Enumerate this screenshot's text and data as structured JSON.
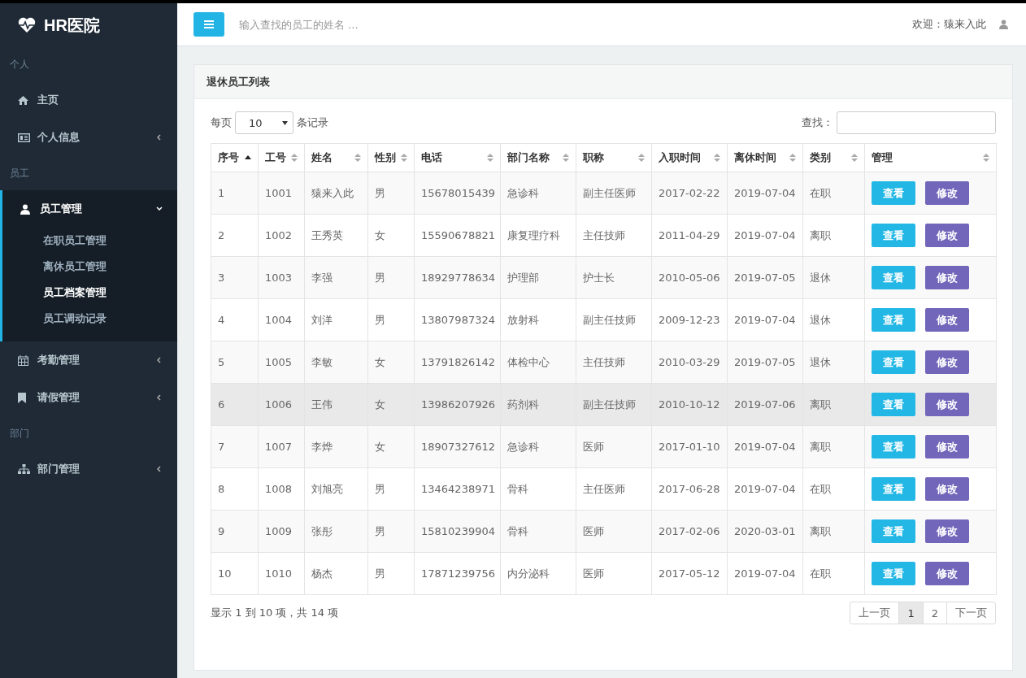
{
  "brand": {
    "title": "HR医院"
  },
  "sidebar": {
    "sections": [
      {
        "heading": "个人",
        "items": [
          {
            "label": "主页",
            "expanded": false,
            "has_caret": false
          },
          {
            "label": "个人信息",
            "expanded": false,
            "has_caret": true
          }
        ]
      },
      {
        "heading": "员工",
        "items": [
          {
            "label": "员工管理",
            "expanded": true,
            "has_caret": true,
            "children": [
              {
                "label": "在职员工管理",
                "selected": false
              },
              {
                "label": "离休员工管理",
                "selected": false
              },
              {
                "label": "员工档案管理",
                "selected": true
              },
              {
                "label": "员工调动记录",
                "selected": false
              }
            ]
          },
          {
            "label": "考勤管理",
            "expanded": false,
            "has_caret": true
          },
          {
            "label": "请假管理",
            "expanded": false,
            "has_caret": true
          }
        ]
      },
      {
        "heading": "部门",
        "items": [
          {
            "label": "部门管理",
            "expanded": false,
            "has_caret": true
          }
        ]
      }
    ]
  },
  "header": {
    "search_placeholder": "输入查找的员工的姓名 ...",
    "welcome": "欢迎：猿来入此"
  },
  "panel": {
    "title": "退休员工列表",
    "per_page_prefix": "每页",
    "per_page_value": "10",
    "per_page_suffix": "条记录",
    "search_label": "查找：",
    "columns": [
      {
        "label": "序号",
        "sorted": true
      },
      {
        "label": "工号",
        "sorted": false
      },
      {
        "label": "姓名",
        "sorted": false
      },
      {
        "label": "性别",
        "sorted": false
      },
      {
        "label": "电话",
        "sorted": false
      },
      {
        "label": "部门名称",
        "sorted": false
      },
      {
        "label": "职称",
        "sorted": false
      },
      {
        "label": "入职时间",
        "sorted": false
      },
      {
        "label": "离休时间",
        "sorted": false
      },
      {
        "label": "类别",
        "sorted": false
      },
      {
        "label": "管理",
        "sorted": false
      }
    ],
    "rows": [
      {
        "hovered": false,
        "cells": [
          "1",
          "1001",
          "猿来入此",
          "男",
          "15678015439",
          "急诊科",
          "副主任医师",
          "2017-02-22",
          "2019-07-04",
          "在职"
        ],
        "actions": [
          "查看",
          "修改"
        ]
      },
      {
        "hovered": false,
        "cells": [
          "2",
          "1002",
          "王秀英",
          "女",
          "15590678821",
          "康复理疗科",
          "主任技师",
          "2011-04-29",
          "2019-07-04",
          "离职"
        ],
        "actions": [
          "查看",
          "修改"
        ]
      },
      {
        "hovered": false,
        "cells": [
          "3",
          "1003",
          "李强",
          "男",
          "18929778634",
          "护理部",
          "护士长",
          "2010-05-06",
          "2019-07-05",
          "退休"
        ],
        "actions": [
          "查看",
          "修改"
        ]
      },
      {
        "hovered": false,
        "cells": [
          "4",
          "1004",
          "刘洋",
          "男",
          "13807987324",
          "放射科",
          "副主任技师",
          "2009-12-23",
          "2019-07-04",
          "退休"
        ],
        "actions": [
          "查看",
          "修改"
        ]
      },
      {
        "hovered": false,
        "cells": [
          "5",
          "1005",
          "李敏",
          "女",
          "13791826142",
          "体检中心",
          "主任技师",
          "2010-03-29",
          "2019-07-05",
          "退休"
        ],
        "actions": [
          "查看",
          "修改"
        ]
      },
      {
        "hovered": true,
        "cells": [
          "6",
          "1006",
          "王伟",
          "女",
          "13986207926",
          "药剂科",
          "副主任技师",
          "2010-10-12",
          "2019-07-06",
          "离职"
        ],
        "actions": [
          "查看",
          "修改"
        ]
      },
      {
        "hovered": false,
        "cells": [
          "7",
          "1007",
          "李烨",
          "女",
          "18907327612",
          "急诊科",
          "医师",
          "2017-01-10",
          "2019-07-04",
          "离职"
        ],
        "actions": [
          "查看",
          "修改"
        ]
      },
      {
        "hovered": false,
        "cells": [
          "8",
          "1008",
          "刘旭亮",
          "男",
          "13464238971",
          "骨科",
          "主任医师",
          "2017-06-28",
          "2019-07-04",
          "在职"
        ],
        "actions": [
          "查看",
          "修改"
        ]
      },
      {
        "hovered": false,
        "cells": [
          "9",
          "1009",
          "张彤",
          "男",
          "15810239904",
          "骨科",
          "医师",
          "2017-02-06",
          "2020-03-01",
          "离职"
        ],
        "actions": [
          "查看",
          "修改"
        ]
      },
      {
        "hovered": false,
        "cells": [
          "10",
          "1010",
          "杨杰",
          "男",
          "17871239756",
          "内分泌科",
          "医师",
          "2017-05-12",
          "2019-07-04",
          "在职"
        ],
        "actions": [
          "查看",
          "修改"
        ]
      }
    ],
    "info": "显示 1 到 10 项，共 14 项",
    "pages": [
      {
        "label": "上一页",
        "selected": false
      },
      {
        "label": "1",
        "selected": true
      },
      {
        "label": "2",
        "selected": false
      },
      {
        "label": "下一页",
        "selected": false
      }
    ]
  }
}
